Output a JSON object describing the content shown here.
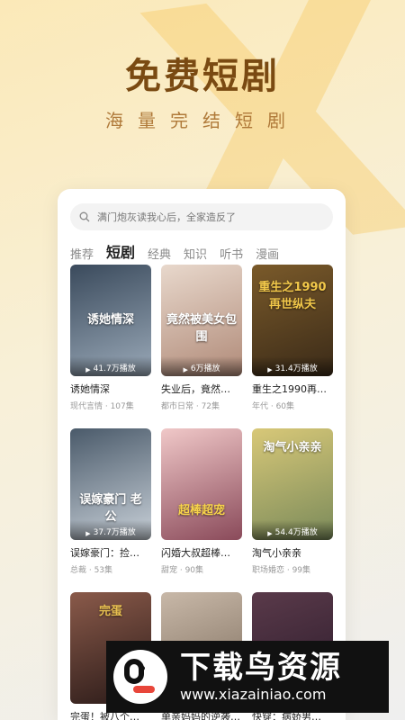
{
  "hero": {
    "title": "免费短剧",
    "subtitle": "海量完结短剧"
  },
  "search": {
    "placeholder": "满门炮灰读我心后，全家造反了"
  },
  "tabs": [
    {
      "label": "推荐"
    },
    {
      "label": "短剧"
    },
    {
      "label": "经典"
    },
    {
      "label": "知识"
    },
    {
      "label": "听书"
    },
    {
      "label": "漫画"
    }
  ],
  "active_tab": "短剧",
  "cards": [
    {
      "title": "诱她情深",
      "meta": "现代言情 · 107集",
      "plays": "41.7万播放",
      "cover_text": "诱她情深",
      "color1": "#3a4a5c",
      "color2": "#9aa9b8"
    },
    {
      "title": "失业后，竟然…",
      "meta": "都市日常 · 72集",
      "plays": "6万播放",
      "cover_text": "竟然被美女包围",
      "color1": "#e8d8cc",
      "color2": "#b08a78"
    },
    {
      "title": "重生之1990再…",
      "meta": "年代 · 60集",
      "plays": "31.4万播放",
      "cover_text": "重生之1990再世纵夫",
      "color1": "#7a5a2a",
      "color2": "#3a2a18"
    },
    {
      "title": "误嫁豪门：捡…",
      "meta": "总裁 · 53集",
      "plays": "37.7万播放",
      "cover_text": "误嫁豪门 老公",
      "color1": "#4a5a6a",
      "color2": "#c8d0d8"
    },
    {
      "title": "闪婚大叔超棒…",
      "meta": "甜宠 · 90集",
      "plays": "",
      "cover_text": "超棒超宠",
      "color1": "#f0c8c8",
      "color2": "#8a4a5a"
    },
    {
      "title": "淘气小亲亲",
      "meta": "职场婚恋 · 99集",
      "plays": "54.4万播放",
      "cover_text": "淘气小亲亲",
      "color1": "#d8c878",
      "color2": "#7a8a5a"
    },
    {
      "title": "完蛋！被八个…",
      "meta": "",
      "plays": "",
      "cover_text": "完蛋",
      "color1": "#8a5a4a",
      "color2": "#2a1a18"
    },
    {
      "title": "单亲妈妈的逆袭…",
      "meta": "",
      "plays": "",
      "cover_text": "",
      "color1": "#c8b8a8",
      "color2": "#7a6a5a"
    },
    {
      "title": "快穿：病娇男…",
      "meta": "",
      "plays": "",
      "cover_text": "",
      "color1": "#5a3a4a",
      "color2": "#2a1a2a"
    }
  ],
  "watermark": {
    "name": "下载鸟资源",
    "url": "www.xiazainiao.com"
  },
  "colors": {
    "accent": "#7a4a12",
    "background": "#fbe9b8"
  }
}
